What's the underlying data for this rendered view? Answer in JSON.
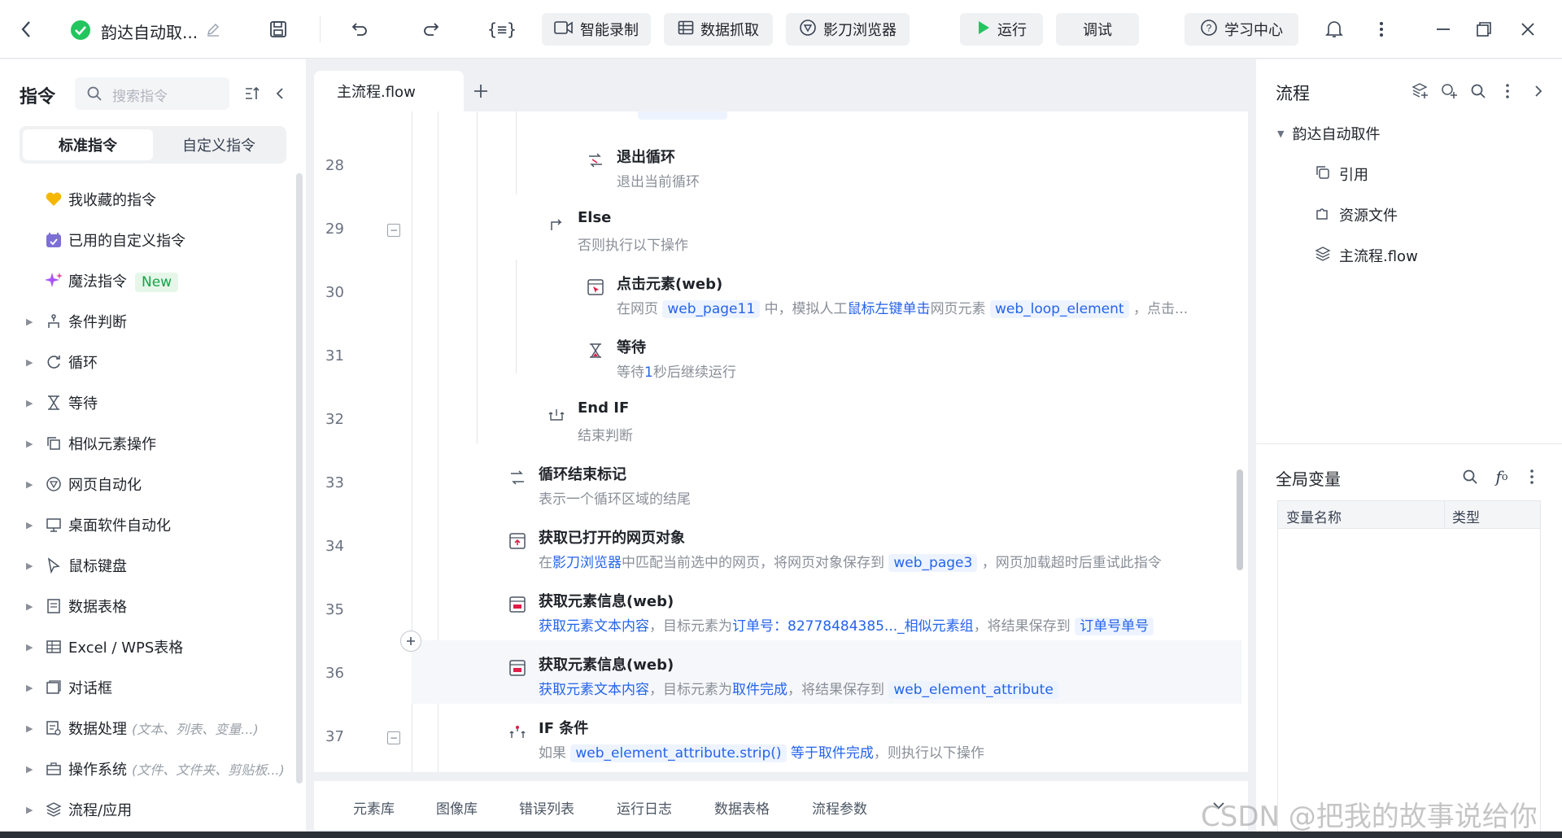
{
  "titlebar": {
    "project_name": "韵达自动取...",
    "smart_record": "智能录制",
    "data_capture": "数据抓取",
    "browser": "影刀浏览器",
    "run": "运行",
    "debug": "调试",
    "learning_center": "学习中心"
  },
  "left": {
    "title": "指令",
    "search_placeholder": "搜索指令",
    "tab_standard": "标准指令",
    "tab_custom": "自定义指令",
    "special": [
      {
        "label": "我收藏的指令",
        "icon": "heart-icon"
      },
      {
        "label": "已用的自定义指令",
        "icon": "calendar-icon"
      },
      {
        "label": "魔法指令",
        "icon": "sparkle-icon",
        "badge": "New"
      }
    ],
    "categories": [
      {
        "label": "条件判断",
        "icon": "branch-icon",
        "hint": ""
      },
      {
        "label": "循环",
        "icon": "loop-icon",
        "hint": ""
      },
      {
        "label": "等待",
        "icon": "hourglass-icon",
        "hint": ""
      },
      {
        "label": "相似元素操作",
        "icon": "copy-icon",
        "hint": ""
      },
      {
        "label": "网页自动化",
        "icon": "browser-icon",
        "hint": ""
      },
      {
        "label": "桌面软件自动化",
        "icon": "monitor-icon",
        "hint": ""
      },
      {
        "label": "鼠标键盘",
        "icon": "cursor-icon",
        "hint": ""
      },
      {
        "label": "数据表格",
        "icon": "document-icon",
        "hint": ""
      },
      {
        "label": "Excel / WPS表格",
        "icon": "excel-icon",
        "hint": ""
      },
      {
        "label": "对话框",
        "icon": "dialog-icon",
        "hint": ""
      },
      {
        "label": "数据处理",
        "icon": "data-icon",
        "hint": "(文本、列表、变量...)"
      },
      {
        "label": "操作系统",
        "icon": "briefcase-icon",
        "hint": "(文件、文件夹、剪贴板...)"
      },
      {
        "label": "流程/应用",
        "icon": "layers-icon",
        "hint": ""
      }
    ]
  },
  "editor": {
    "tab": "主流程.flow",
    "line_numbers": [
      "28",
      "29",
      "30",
      "31",
      "32",
      "33",
      "34",
      "35",
      "36",
      "37"
    ],
    "statements": {
      "exit_loop": {
        "title": "退出循环",
        "desc": "退出当前循环"
      },
      "else": {
        "title": "Else",
        "desc": "否则执行以下操作"
      },
      "click": {
        "title": "点击元素(web)",
        "d1": "在网页",
        "v1": "web_page11",
        "d2": "中，模拟人工",
        "l1": "鼠标左键单击",
        "d3": "网页元素",
        "v2": "web_loop_element",
        "d4": "，点击..."
      },
      "wait": {
        "title": "等待",
        "d1": "等待",
        "n1": "1",
        "d2": "秒后继续运行"
      },
      "endif": {
        "title": "End IF",
        "desc": "结束判断"
      },
      "loop_end": {
        "title": "循环结束标记",
        "desc": "表示一个循环区域的结尾"
      },
      "get_page": {
        "title": "获取已打开的网页对象",
        "d1": "在",
        "l1": "影刀浏览器",
        "d2": "中匹配当前选中的网页，将网页对象保存到",
        "v1": "web_page3",
        "d3": "，网页加载超时后重试此指令"
      },
      "get_info1": {
        "title": "获取元素信息(web)",
        "l1": "获取元素文本内容",
        "d1": "，目标元素为",
        "l2": "订单号：82778484385..._相似元素组",
        "d2": "，将结果保存到",
        "v1": "订单号单号"
      },
      "get_info2": {
        "title": "获取元素信息(web)",
        "l1": "获取元素文本内容",
        "d1": "，目标元素为",
        "l2": "取件完成",
        "d2": "，将结果保存到",
        "v1": "web_element_attribute"
      },
      "if_cond": {
        "title": "IF 条件",
        "d1": "如果",
        "v1": "web_element_attribute.strip()",
        "l1": "等于取件完成",
        "d2": "，则执行以下操作"
      }
    }
  },
  "bottom_tabs": [
    "元素库",
    "图像库",
    "错误列表",
    "运行日志",
    "数据表格",
    "流程参数"
  ],
  "right": {
    "flow_title": "流程",
    "tree_root": "韵达自动取件",
    "tree_items": [
      {
        "label": "引用",
        "icon": "reference-icon"
      },
      {
        "label": "资源文件",
        "icon": "puzzle-icon"
      },
      {
        "label": "主流程.flow",
        "icon": "layers-icon"
      }
    ],
    "globals_title": "全局变量",
    "col_name": "变量名称",
    "col_type": "类型"
  },
  "watermark": "CSDN @把我的故事说给你",
  "colors": {
    "accent": "#2563eb",
    "run_green": "#22c55e",
    "check_green": "#22c55e"
  }
}
